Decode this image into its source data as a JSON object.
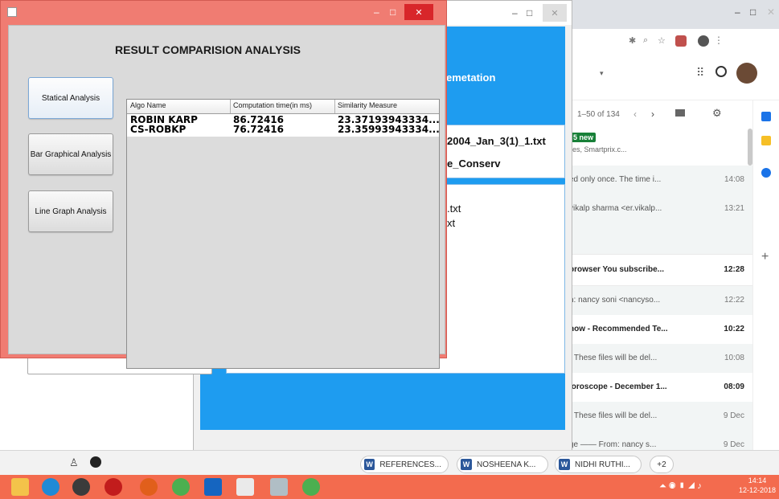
{
  "front_window": {
    "title": "RESULT COMPARISION ANALYSIS",
    "buttons": [
      "Statical Analysis",
      "Bar Graphical Analysis",
      "Line Graph Analysis"
    ],
    "table": {
      "headers": [
        "Algo Name",
        "Computation time(in ms)",
        "Similarity Measure"
      ],
      "rows": [
        [
          "ROBIN KARP",
          "86.72416",
          "23.37193943334..."
        ],
        [
          "CS-ROBKP",
          "76.72416",
          "23.35993943334..."
        ]
      ]
    },
    "controls": {
      "minimize": "–",
      "maximize": "□",
      "close": "✕"
    }
  },
  "middle_window": {
    "panel_1": "emetation",
    "panel_2": "2004_Jan_3(1)_1.txt",
    "panel_3": "e_Conserv",
    "panel_4_line_1": ".txt",
    "panel_4_line_2": "xt",
    "controls": {
      "minimize": "–",
      "maximize": "□",
      "close": "✕"
    }
  },
  "browser": {
    "controls": {
      "minimize": "–",
      "maximize": "□",
      "close": "✕"
    },
    "pagination": "1–50 of 134",
    "badge": "5 new",
    "badge_sub": "ies, Smartprix.c...",
    "mails": [
      {
        "snippet": "ed only once. The time i...",
        "time": "14:08",
        "unread": false
      },
      {
        "snippet": "vikalp sharma <er.vikalp...",
        "time": "13:21",
        "unread": false
      },
      {
        "snippet": "browser You subscribe...",
        "time": "12:28",
        "unread": true
      },
      {
        "snippet": "n: nancy soni <nancyso...",
        "time": "12:22",
        "unread": false
      },
      {
        "snippet": "now - Recommended Te...",
        "time": "10:22",
        "unread": true
      },
      {
        "snippet": "- These files will be del...",
        "time": "10:08",
        "unread": false
      },
      {
        "snippet": "loroscope - December 1...",
        "time": "08:09",
        "unread": true
      },
      {
        "snippet": "- These files will be del...",
        "time": "9 Dec",
        "unread": false
      },
      {
        "snippet": "ge —— From: nancy s...",
        "time": "9 Dec",
        "unread": false
      }
    ]
  },
  "downloads": {
    "items": [
      "REFERENCES...",
      "NOSHEENA K...",
      "NIDHI RUTHI..."
    ],
    "more": "+2"
  },
  "taskbar": {
    "time": "14:14",
    "date": "12-12-2018"
  },
  "colors": {
    "front_frame": "#f07c72",
    "middle_blue": "#1e9cf0",
    "taskbar": "#f36b4e"
  }
}
